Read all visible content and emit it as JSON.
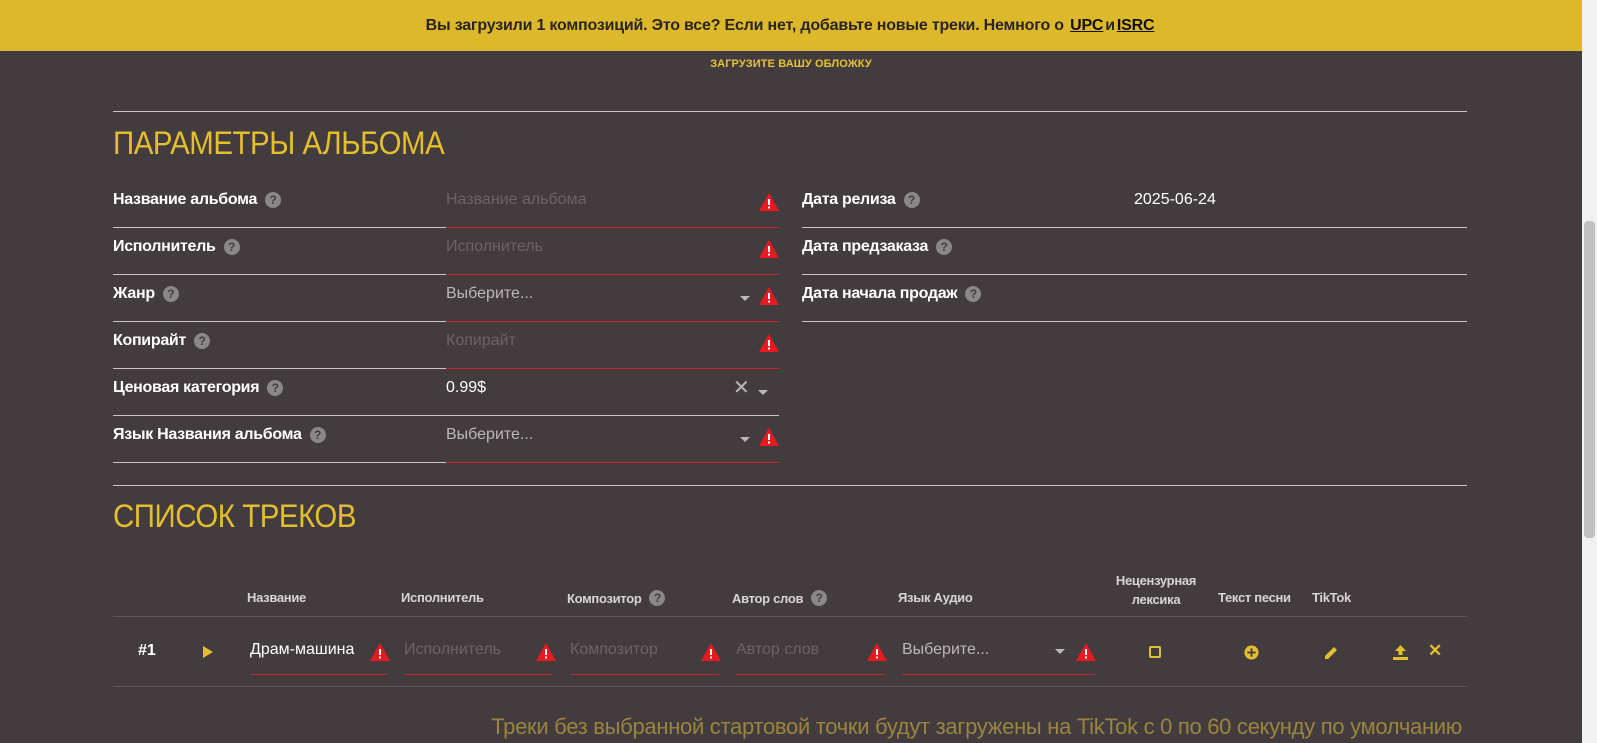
{
  "banner": {
    "text": "Вы загрузили 1 композиций. Это все? Если нет, добавьте новые треки. Немного о",
    "upc": "UPC",
    "and": "и",
    "isrc": "ISRC"
  },
  "cover_link": "ЗАГРУЗИТЕ ВАШУ ОБЛОЖКУ",
  "album_section": {
    "title": "ПАРАМЕТРЫ АЛЬБОМА",
    "left_fields": [
      {
        "label": "Название альбома",
        "placeholder": "Название альбома",
        "value": ""
      },
      {
        "label": "Исполнитель",
        "placeholder": "Исполнитель",
        "value": ""
      },
      {
        "label": "Жанр",
        "placeholder": "Выберите...",
        "value": ""
      },
      {
        "label": "Копирайт",
        "placeholder": "Копирайт",
        "value": ""
      },
      {
        "label": "Ценовая категория",
        "placeholder": "",
        "value": "0.99$"
      },
      {
        "label": "Язык Названия альбома",
        "placeholder": "Выберите...",
        "value": ""
      }
    ],
    "right_fields": [
      {
        "label": "Дата релиза",
        "value": "2025-06-24"
      },
      {
        "label": "Дата предзаказа",
        "value": ""
      },
      {
        "label": "Дата начала продаж",
        "value": ""
      }
    ]
  },
  "tracks_section": {
    "title": "СПИСОК ТРЕКОВ",
    "headers": {
      "name": "Название",
      "artist": "Исполнитель",
      "composer": "Композитор",
      "lyricist": "Автор слов",
      "audio_lang": "Язык Аудио",
      "explicit_line1": "Нецензурная",
      "explicit_line2": "лексика",
      "lyrics": "Текст песни",
      "tiktok": "TikTok"
    },
    "rows": [
      {
        "number": "#1",
        "name": "Драм-машина",
        "artist_placeholder": "Исполнитель",
        "composer_placeholder": "Композитор",
        "lyricist_placeholder": "Автор слов",
        "audio_lang_placeholder": "Выберите..."
      }
    ],
    "note": "Треки без выбранной стартовой точки будут загружены на TikTok с 0 по 60 секунду по умолчанию"
  },
  "colors": {
    "accent": "#e5be2d",
    "banner": "#dcb82a",
    "background": "#433c3e",
    "error": "#e8191f"
  }
}
